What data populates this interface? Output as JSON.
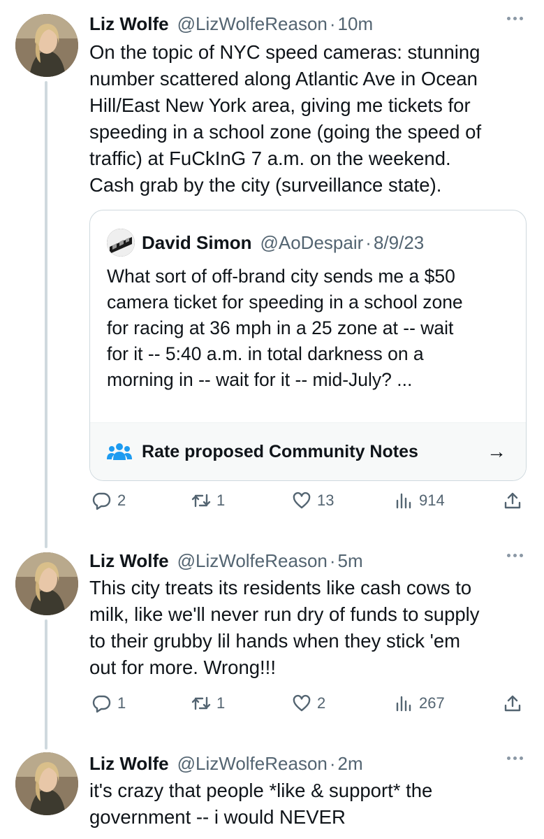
{
  "tweets": [
    {
      "name": "Liz Wolfe",
      "handle": "@LizWolfeReason",
      "time": "10m",
      "text": "On the topic of NYC speed cameras: stunning\nnumber scattered along Atlantic Ave in Ocean\nHill/East New York area, giving me tickets for\nspeeding in a school zone (going the speed of\ntraffic) at FuCkInG 7 a.m. on the weekend.\nCash grab by the city (surveillance state).",
      "quote": {
        "name": "David Simon",
        "handle": "@AoDespair",
        "time": "8/9/23",
        "text": "What sort of off-brand city sends me a $50\ncamera ticket for speeding in a school zone\nfor racing at 36 mph in a 25 zone at -- wait\nfor it -- 5:40 a.m. in total darkness on a\nmorning in -- wait for it -- mid-July? ...",
        "notes_label": "Rate proposed Community Notes",
        "arrow": "→"
      },
      "stats": {
        "replies": "2",
        "reposts": "1",
        "likes": "13",
        "views": "914"
      }
    },
    {
      "name": "Liz Wolfe",
      "handle": "@LizWolfeReason",
      "time": "5m",
      "text": "This city treats its residents like cash cows to\nmilk, like we'll never run dry of funds to supply\nto their grubby lil hands when they stick 'em\nout for more. Wrong!!!",
      "stats": {
        "replies": "1",
        "reposts": "1",
        "likes": "2",
        "views": "267"
      }
    },
    {
      "name": "Liz Wolfe",
      "handle": "@LizWolfeReason",
      "time": "2m",
      "text": "it's crazy that people *like & support* the\ngovernment -- i would NEVER"
    }
  ],
  "separator": "·",
  "colors": {
    "secondary": "#536471",
    "thread_line": "#cfd9de",
    "text": "#0f1419"
  },
  "icons": [
    "reply-icon",
    "repost-icon",
    "like-icon",
    "views-icon",
    "share-icon",
    "more-icon",
    "community-notes-icon",
    "arrow-right-icon"
  ]
}
